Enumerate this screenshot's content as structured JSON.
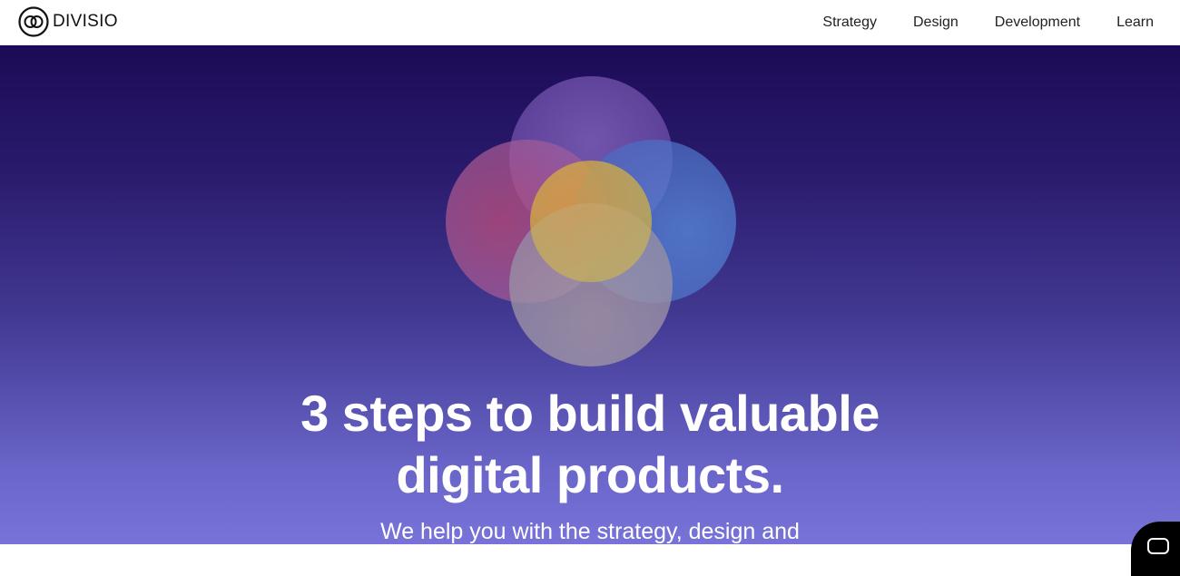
{
  "header": {
    "logo_text": "DIVISIO",
    "nav": [
      {
        "label": "Strategy"
      },
      {
        "label": "Design"
      },
      {
        "label": "Development"
      },
      {
        "label": "Learn"
      }
    ]
  },
  "hero": {
    "headline_line1": "3 steps to build valuable",
    "headline_line2": "digital products.",
    "subline": "We help you with the strategy, design and"
  },
  "colors": {
    "hero_gradient_top": "#1b0b56",
    "hero_gradient_bottom": "#7873d8",
    "circle_purple": "#7a5bb8",
    "circle_red": "#c0507a",
    "circle_blue": "#5a8ee0",
    "circle_beige": "#b0a4a8",
    "circle_gold": "#d9a838"
  },
  "icons": {
    "logo": "divisio-logo-icon",
    "chat": "chat-icon"
  }
}
